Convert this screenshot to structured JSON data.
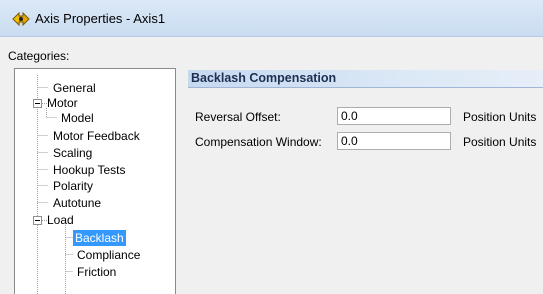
{
  "window": {
    "title": "Axis Properties - Axis1"
  },
  "categories": {
    "label": "Categories:",
    "items": [
      {
        "label": "General"
      },
      {
        "label": "Motor"
      },
      {
        "label": "Model"
      },
      {
        "label": "Motor Feedback"
      },
      {
        "label": "Scaling"
      },
      {
        "label": "Hookup Tests"
      },
      {
        "label": "Polarity"
      },
      {
        "label": "Autotune"
      },
      {
        "label": "Load"
      },
      {
        "label": "Backlash"
      },
      {
        "label": "Compliance"
      },
      {
        "label": "Friction"
      }
    ],
    "selected": "Backlash"
  },
  "panel": {
    "title": "Backlash Compensation",
    "fields": [
      {
        "label": "Reversal Offset:",
        "value": "0.0",
        "unit": "Position Units"
      },
      {
        "label": "Compensation Window:",
        "value": "0.0",
        "unit": "Position Units"
      }
    ]
  },
  "colors": {
    "selection": "#3399ff",
    "titlebar": "#dce9f7",
    "section_header": "#c5d9f0"
  }
}
